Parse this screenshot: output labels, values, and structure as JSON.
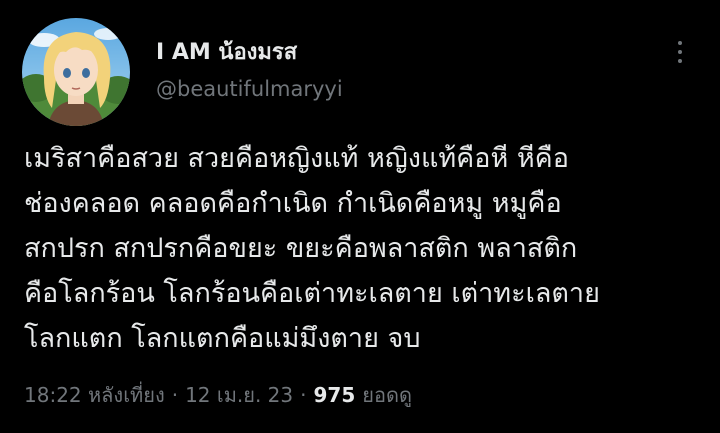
{
  "author": {
    "display_name": "I AM น้องมรส",
    "handle": "@beautifulmaryyi",
    "avatar_icon": "anime-character-avatar"
  },
  "more_icon": "more-vertical-icon",
  "tweet": {
    "lines": [
      "เมริสาคือสวย สวยคือหญิงแท้ หญิงแท้คือหี หีคือ",
      "ช่องคลอด คลอดคือกำเนิด กำเนิดคือหมู หมูคือ",
      "สกปรก สกปรกคือขยะ ขยะคือพลาสติก พลาสติก",
      "คือโลกร้อน โลกร้อนคือเต่าทะเลตาย เต่าทะเลตาย",
      "โลกแตก โลกแตกคือแม่มึงตาย จบ"
    ]
  },
  "meta": {
    "time": "18:22 หลังเที่ยง",
    "separator": "·",
    "date": "12 เม.ย. 23",
    "views_count": "975",
    "views_label": "ยอดดู"
  },
  "colors": {
    "background": "#000000",
    "primary_text": "#e7e9ea",
    "secondary_text": "#71767b"
  }
}
